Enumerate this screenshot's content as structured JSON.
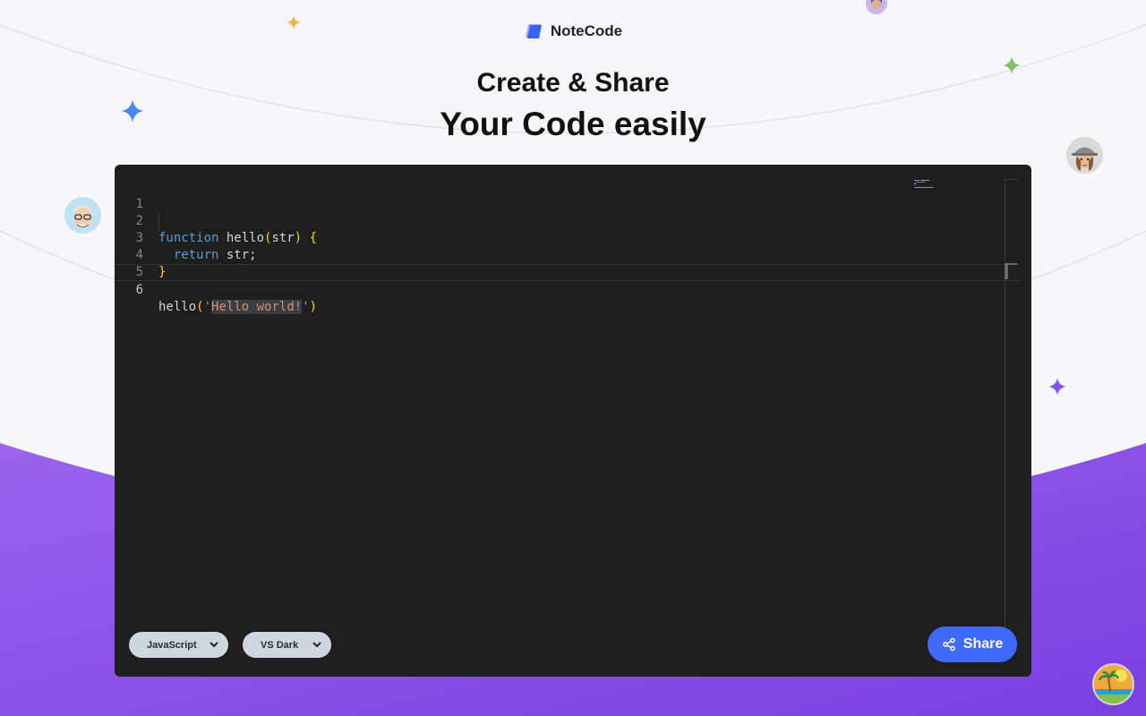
{
  "brand": {
    "name": "NoteCode",
    "icon": "notecode-logo-icon"
  },
  "header": {
    "line1": "Create & Share",
    "line2": "Your Code easily"
  },
  "editor": {
    "language": "JavaScript",
    "lines": [
      {
        "number": "1"
      },
      {
        "number": "2"
      },
      {
        "number": "3"
      },
      {
        "number": "4"
      },
      {
        "number": "5"
      },
      {
        "number": "6"
      }
    ],
    "tokens": {
      "l2_kw": "function",
      "l2_name": " hello",
      "l2_open": "(",
      "l2_param": "str",
      "l2_close": ")",
      "l2_space": " ",
      "l2_brace": "{",
      "l3_indent": "  ",
      "l3_kw": "return",
      "l3_rest": " str;",
      "l4_brace": "}",
      "l6_call": "hello",
      "l6_open": "(",
      "l6_quote1": "'",
      "l6_str": "Hello world!",
      "l6_quote2": "'",
      "l6_close": ")"
    }
  },
  "toolbar": {
    "language_select": "JavaScript",
    "theme_select": "VS Dark",
    "share_label": "Share"
  },
  "colors": {
    "accent": "#406aff",
    "purple_band": "#8a55e8",
    "editor_bg": "#1e1e1e"
  }
}
